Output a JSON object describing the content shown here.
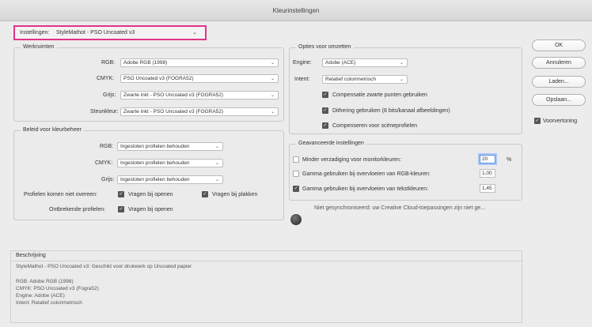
{
  "window": {
    "title": "Kleurinstellingen"
  },
  "settings": {
    "label": "Instellingen:",
    "value": "StyleMathot - PSO Uncoated v3"
  },
  "working_spaces": {
    "title": "Werkruimten",
    "rgb": {
      "label": "RGB:",
      "value": "Adobe RGB (1998)"
    },
    "cmyk": {
      "label": "CMYK:",
      "value": "PSO Uncoated v3 (FOGRA52)"
    },
    "gray": {
      "label": "Grijs:",
      "value": "Zwarte inkt - PSO Uncoated v3 (FOGRA52)"
    },
    "spot": {
      "label": "Steunkleur:",
      "value": "Zwarte inkt - PSO Uncoated v3 (FOGRA52)"
    }
  },
  "policies": {
    "title": "Beleid voor kleurbeheer",
    "rgb": {
      "label": "RGB:",
      "value": "Ingesloten profielen behouden"
    },
    "cmyk": {
      "label": "CMYK:",
      "value": "Ingesloten profielen behouden"
    },
    "gray": {
      "label": "Grijs:",
      "value": "Ingesloten profielen behouden"
    },
    "mismatch_label": "Profielen komen niet overeen:",
    "ask_open": "Vragen bij openen",
    "ask_paste": "Vragen bij plakken",
    "missing_label": "Ontbrekende profielen:",
    "ask_open2": "Vragen bij openen"
  },
  "conversion": {
    "title": "Opties voor omzetten",
    "engine": {
      "label": "Engine:",
      "value": "Adobe (ACE)"
    },
    "intent": {
      "label": "Intent:",
      "value": "Relatief colorimetrisch"
    },
    "black_point": "Compensatie zwarte punten gebruiken",
    "dither": "Dithering gebruiken (8 bits/kanaal afbeeldingen)",
    "scene": "Compenseren voor scèneprofielen"
  },
  "advanced": {
    "title": "Geavanceerde instellingen",
    "desat": {
      "label": "Minder verzadiging voor monitorkleuren:",
      "value": "20",
      "unit": "%"
    },
    "blend_rgb": {
      "label": "Gamma gebruiken bij overvloeien van RGB-kleuren:",
      "value": "1,00"
    },
    "blend_text": {
      "label": "Gamma gebruiken bij overvloeien van tekstkleuren:",
      "value": "1,45"
    },
    "sync_status": "Niet gesynchroniseerd: uw Creative Cloud-toepassingen zijn niet ge..."
  },
  "buttons": {
    "ok": "OK",
    "cancel": "Annuleren",
    "load": "Laden...",
    "save": "Opslaan...",
    "preview": "Voorvertoning"
  },
  "description": {
    "title": "Beschrijving",
    "l1": "StyleMathot - PSO Uncoated v3: Geschikt voor drukwerk op Uncoated papier",
    "l2": "RGB: Adobe RGB (1998)",
    "l3": "CMYK: PSO Uncoated v3 (Fogra52)",
    "l4": "Engine: Adobe (ACE)",
    "l5": "Intent: Relatief colorimetrisch"
  },
  "colors": {
    "highlight": "#e0338a",
    "focus": "#5a8de0"
  }
}
